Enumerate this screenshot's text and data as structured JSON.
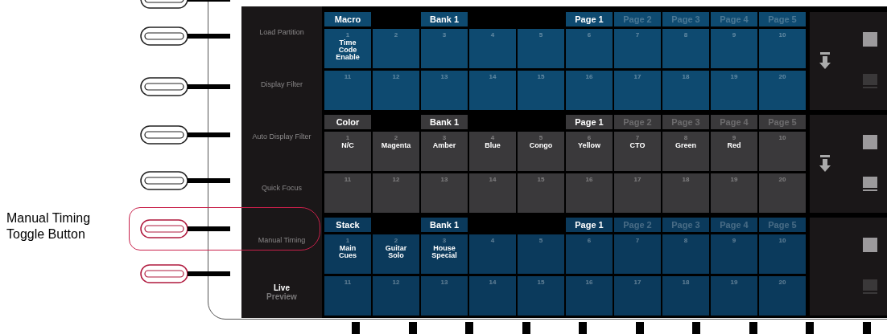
{
  "callout": {
    "text": "Manual Timing Toggle Button"
  },
  "hardware_buttons": [
    {
      "highlighted": false
    },
    {
      "highlighted": false
    },
    {
      "highlighted": false
    },
    {
      "highlighted": false
    },
    {
      "highlighted": false
    },
    {
      "highlighted": true
    },
    {
      "highlighted": true
    }
  ],
  "side_labels": [
    "Load Partition",
    "Display Filter",
    "Auto Display Filter",
    "Quick Focus",
    "Manual Timing"
  ],
  "mode_toggle": [
    {
      "label": "Live",
      "selected": true
    },
    {
      "label": "Preview",
      "selected": false
    }
  ],
  "sections": [
    {
      "type": "Macro",
      "bank": "Bank 1",
      "color": "#0e4a70",
      "pages": [
        {
          "label": "Page 1",
          "selected": true
        },
        {
          "label": "Page 2",
          "selected": false
        },
        {
          "label": "Page 3",
          "selected": false
        },
        {
          "label": "Page 4",
          "selected": false
        },
        {
          "label": "Page 5",
          "selected": false
        }
      ],
      "cells": [
        {
          "number": "1",
          "label": "Time Code Enable"
        },
        {
          "number": "2"
        },
        {
          "number": "3"
        },
        {
          "number": "4"
        },
        {
          "number": "5"
        },
        {
          "number": "6"
        },
        {
          "number": "7"
        },
        {
          "number": "8"
        },
        {
          "number": "9"
        },
        {
          "number": "10"
        },
        {
          "number": "11"
        },
        {
          "number": "12"
        },
        {
          "number": "13"
        },
        {
          "number": "14"
        },
        {
          "number": "15"
        },
        {
          "number": "16"
        },
        {
          "number": "17"
        },
        {
          "number": "18"
        },
        {
          "number": "19"
        },
        {
          "number": "20"
        }
      ],
      "load_arrow": true,
      "lower_button_enabled": false
    },
    {
      "type": "Color",
      "bank": "Bank 1",
      "color": "#3a393b",
      "pages": [
        {
          "label": "Page 1",
          "selected": true
        },
        {
          "label": "Page 2",
          "selected": false
        },
        {
          "label": "Page 3",
          "selected": false
        },
        {
          "label": "Page 4",
          "selected": false
        },
        {
          "label": "Page 5",
          "selected": false
        }
      ],
      "cells": [
        {
          "number": "1",
          "label": "N/C"
        },
        {
          "number": "2",
          "label": "Magenta"
        },
        {
          "number": "3",
          "label": "Amber"
        },
        {
          "number": "4",
          "label": "Blue"
        },
        {
          "number": "5",
          "label": "Congo"
        },
        {
          "number": "6",
          "label": "Yellow"
        },
        {
          "number": "7",
          "label": "CTO"
        },
        {
          "number": "8",
          "label": "Green"
        },
        {
          "number": "9",
          "label": "Red"
        },
        {
          "number": "10"
        },
        {
          "number": "11"
        },
        {
          "number": "12"
        },
        {
          "number": "13"
        },
        {
          "number": "14"
        },
        {
          "number": "15"
        },
        {
          "number": "16"
        },
        {
          "number": "17"
        },
        {
          "number": "18"
        },
        {
          "number": "19"
        },
        {
          "number": "20"
        }
      ],
      "load_arrow": true,
      "lower_button_enabled": true
    },
    {
      "type": "Stack",
      "bank": "Bank 1",
      "color": "#0b3a5c",
      "pages": [
        {
          "label": "Page 1",
          "selected": true
        },
        {
          "label": "Page 2",
          "selected": false
        },
        {
          "label": "Page 3",
          "selected": false
        },
        {
          "label": "Page 4",
          "selected": false
        },
        {
          "label": "Page 5",
          "selected": false
        }
      ],
      "cells": [
        {
          "number": "1",
          "label": "Main Cues"
        },
        {
          "number": "2",
          "label": "Guitar Solo"
        },
        {
          "number": "3",
          "label": "House Special"
        },
        {
          "number": "4"
        },
        {
          "number": "5"
        },
        {
          "number": "6"
        },
        {
          "number": "7"
        },
        {
          "number": "8"
        },
        {
          "number": "9"
        },
        {
          "number": "10"
        },
        {
          "number": "11"
        },
        {
          "number": "12"
        },
        {
          "number": "13"
        },
        {
          "number": "14"
        },
        {
          "number": "15"
        },
        {
          "number": "16"
        },
        {
          "number": "17"
        },
        {
          "number": "18"
        },
        {
          "number": "19"
        },
        {
          "number": "20"
        }
      ],
      "load_arrow": false,
      "lower_button_enabled": false
    }
  ]
}
